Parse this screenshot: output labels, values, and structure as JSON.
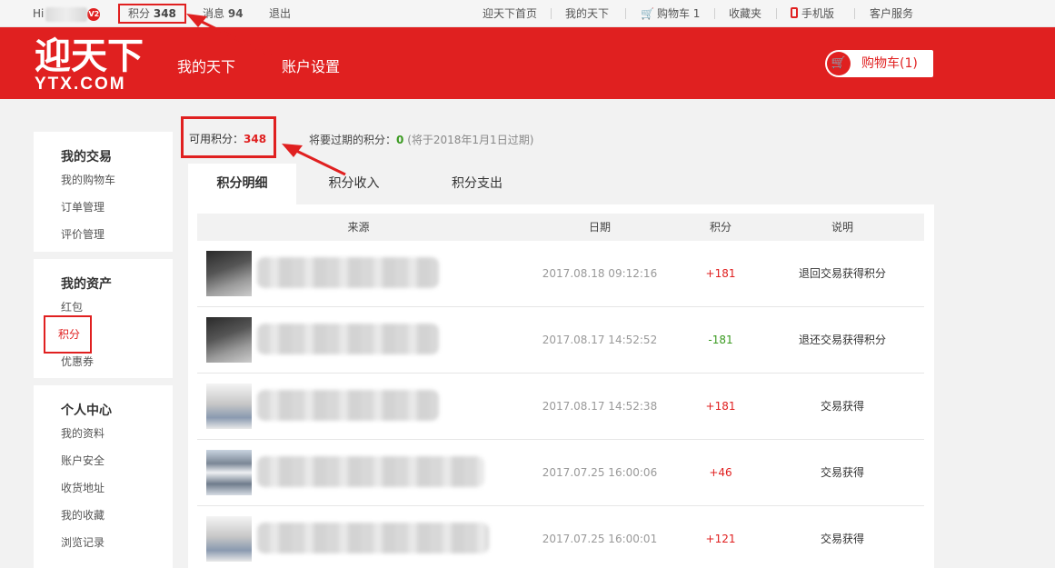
{
  "topbar": {
    "hi": "Hi",
    "vip_badge": "V2",
    "points_label": "积分",
    "points_value": "348",
    "messages_label": "消息",
    "messages_value": "94",
    "logout": "退出",
    "home": "迎天下首页",
    "my_ytx": "我的天下",
    "cart": "购物车 1",
    "favorites": "收藏夹",
    "mobile": "手机版",
    "service": "客户服务"
  },
  "header": {
    "logo_cn": "迎天下",
    "logo_en": "YTX.COM",
    "nav": [
      "我的天下",
      "账户设置"
    ],
    "cart_button": "购物车(1)"
  },
  "sidebar": {
    "sections": [
      {
        "title": "我的交易",
        "items": [
          "我的购物车",
          "订单管理",
          "评价管理"
        ]
      },
      {
        "title": "我的资产",
        "items": [
          "红包",
          "积分",
          "优惠券"
        ],
        "active": "积分"
      },
      {
        "title": "个人中心",
        "items": [
          "我的资料",
          "账户安全",
          "收货地址",
          "我的收藏",
          "浏览记录"
        ]
      }
    ]
  },
  "summary": {
    "available_label": "可用积分：",
    "available_value": "348",
    "expire_label": "将要过期的积分：",
    "expire_value": "0",
    "expire_note": "(将于2018年1月1日过期)"
  },
  "tabs": [
    "积分明细",
    "积分收入",
    "积分支出"
  ],
  "table": {
    "headers": [
      "来源",
      "日期",
      "积分",
      "说明"
    ],
    "rows": [
      {
        "date": "2017.08.18 09:12:16",
        "points": "+181",
        "desc": "退回交易获得积分"
      },
      {
        "date": "2017.08.17 14:52:52",
        "points": "-181",
        "desc": "退还交易获得积分"
      },
      {
        "date": "2017.08.17 14:52:38",
        "points": "+181",
        "desc": "交易获得"
      },
      {
        "date": "2017.07.25 16:00:06",
        "points": "+46",
        "desc": "交易获得"
      },
      {
        "date": "2017.07.25 16:00:01",
        "points": "+121",
        "desc": "交易获得"
      }
    ]
  },
  "colors": {
    "brand": "#e02020",
    "negative": "#3a9a20"
  }
}
